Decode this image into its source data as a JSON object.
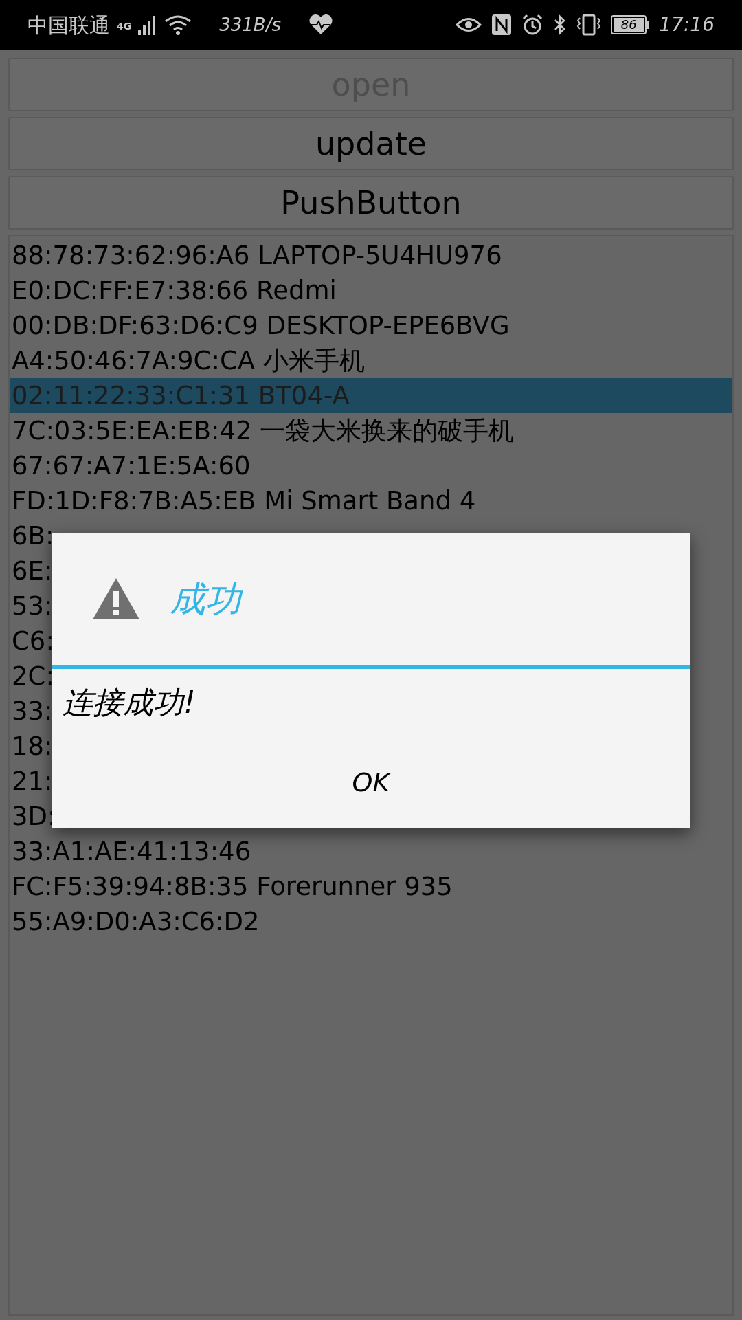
{
  "status_bar": {
    "carrier": "中国联通",
    "network": "4G",
    "speed": "331B/s",
    "battery": "86",
    "time": "17:16"
  },
  "buttons": [
    {
      "label": "open",
      "disabled": true
    },
    {
      "label": "update",
      "disabled": false
    },
    {
      "label": "PushButton",
      "disabled": false
    }
  ],
  "devices": [
    {
      "text": "88:78:73:62:96:A6 LAPTOP-5U4HU976",
      "selected": false
    },
    {
      "text": "E0:DC:FF:E7:38:66 Redmi",
      "selected": false
    },
    {
      "text": "00:DB:DF:63:D6:C9 DESKTOP-EPE6BVG",
      "selected": false
    },
    {
      "text": "A4:50:46:7A:9C:CA 小米手机",
      "selected": false
    },
    {
      "text": "02:11:22:33:C1:31 BT04-A",
      "selected": true
    },
    {
      "text": "7C:03:5E:EA:EB:42 一袋大米换来的破手机",
      "selected": false
    },
    {
      "text": "67:67:A7:1E:5A:60",
      "selected": false
    },
    {
      "text": "FD:1D:F8:7B:A5:EB Mi Smart Band 4",
      "selected": false
    },
    {
      "text": "6B:",
      "selected": false
    },
    {
      "text": "6E:",
      "selected": false
    },
    {
      "text": "53:",
      "selected": false
    },
    {
      "text": "C6:",
      "selected": false
    },
    {
      "text": "2C:",
      "selected": false
    },
    {
      "text": "33:",
      "selected": false
    },
    {
      "text": "18:",
      "selected": false
    },
    {
      "text": "21:",
      "selected": false
    },
    {
      "text": "3D:",
      "selected": false
    },
    {
      "text": "33:A1:AE:41:13:46",
      "selected": false
    },
    {
      "text": "FC:F5:39:94:8B:35 Forerunner 935",
      "selected": false
    },
    {
      "text": "55:A9:D0:A3:C6:D2",
      "selected": false
    }
  ],
  "dialog": {
    "title": "成功",
    "message": "连接成功!",
    "button": "OK"
  }
}
